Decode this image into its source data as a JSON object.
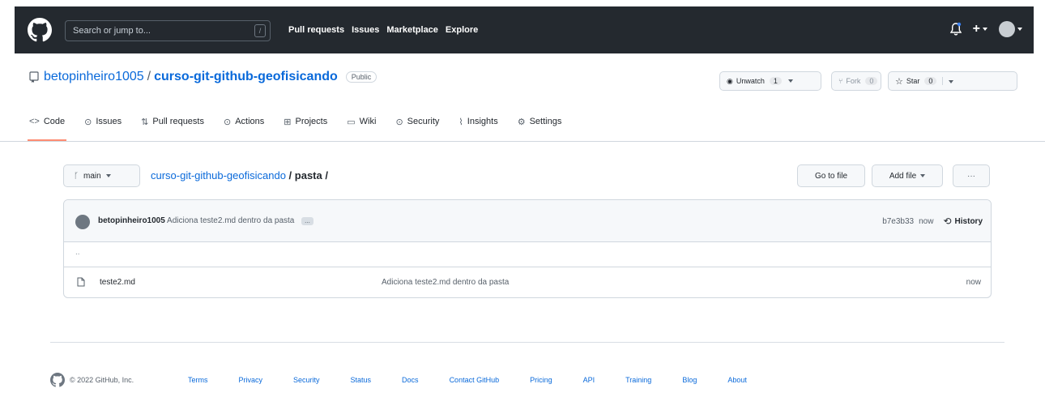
{
  "header": {
    "search_placeholder": "Search or jump to...",
    "search_shortcut": "/",
    "nav": [
      "Pull requests",
      "Issues",
      "Marketplace",
      "Explore"
    ],
    "plus_label": "+"
  },
  "repo": {
    "owner": "betopinheiro1005",
    "separator": "/",
    "name": "curso-git-github-geofisicando",
    "visibility": "Public",
    "unwatch_label": "Unwatch",
    "unwatch_count": "1",
    "fork_label": "Fork",
    "fork_count": "0",
    "star_label": "Star",
    "star_count": "0"
  },
  "tabs": [
    {
      "label": "Code",
      "icon": "<>"
    },
    {
      "label": "Issues",
      "icon": "⊙"
    },
    {
      "label": "Pull requests",
      "icon": "⇅"
    },
    {
      "label": "Actions",
      "icon": "⊙"
    },
    {
      "label": "Projects",
      "icon": "⊞"
    },
    {
      "label": "Wiki",
      "icon": "▭"
    },
    {
      "label": "Security",
      "icon": "⊙"
    },
    {
      "label": "Insights",
      "icon": "⌇"
    },
    {
      "label": "Settings",
      "icon": "⚙"
    }
  ],
  "filenav": {
    "branch": "main",
    "crumb_repo": "curso-git-github-geofisicando",
    "crumb_rest": " / pasta /",
    "go_to_file": "Go to file",
    "add_file": "Add file",
    "more": "···"
  },
  "commit": {
    "author": "betopinheiro1005",
    "message": "Adiciona teste2.md dentro da pasta",
    "ellipsis": "...",
    "sha": "b7e3b33",
    "age": "now",
    "history": "History"
  },
  "files": {
    "updir": "..",
    "rows": [
      {
        "name": "teste2.md",
        "message": "Adiciona teste2.md dentro da pasta",
        "age": "now"
      }
    ]
  },
  "footer": {
    "copyright": "© 2022 GitHub, Inc.",
    "links": [
      "Terms",
      "Privacy",
      "Security",
      "Status",
      "Docs",
      "Contact GitHub",
      "Pricing",
      "API",
      "Training",
      "Blog",
      "About"
    ]
  },
  "colors": {
    "header_bg": "#24292f",
    "link": "#0969da",
    "tab_underline": "#fd8c73"
  }
}
